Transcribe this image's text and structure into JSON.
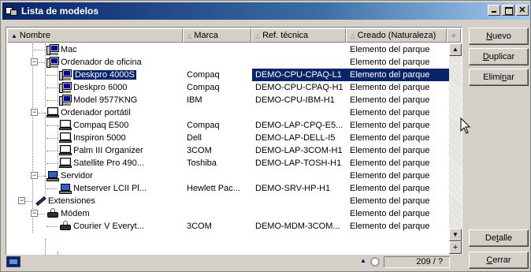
{
  "window": {
    "title": "Lista de modelos"
  },
  "columns": {
    "name": "Nombre",
    "brand": "Marca",
    "ref": "Ref. técnica",
    "created": "Creado (Naturaleza)",
    "add": "+"
  },
  "rows": [
    {
      "name": "Mac",
      "brand": "",
      "ref": "",
      "created": "Elemento del parque",
      "icon": "desktop-icon",
      "level": 2
    },
    {
      "name": "Ordenador de oficina",
      "brand": "",
      "ref": "",
      "created": "Elemento del parque",
      "icon": "desktop-icon",
      "level": 2,
      "expander": "−"
    },
    {
      "name": "Deskpro 4000S",
      "brand": "Compaq",
      "ref": "DEMO-CPU-CPAQ-L1",
      "created": "Elemento del parque",
      "icon": "desktop-icon",
      "level": 3,
      "selected": true
    },
    {
      "name": "Deskpro 6000",
      "brand": "Compaq",
      "ref": "DEMO-CPU-CPAQ-H1",
      "created": "Elemento del parque",
      "icon": "desktop-icon",
      "level": 3
    },
    {
      "name": "Model 9577KNG",
      "brand": "IBM",
      "ref": "DEMO-CPU-IBM-H1",
      "created": "Elemento del parque",
      "icon": "desktop-icon",
      "level": 3
    },
    {
      "name": "Ordenador portátil",
      "brand": "",
      "ref": "",
      "created": "Elemento del parque",
      "icon": "laptop-icon",
      "level": 2,
      "expander": "−"
    },
    {
      "name": "Compaq E500",
      "brand": "Compaq",
      "ref": "DEMO-LAP-CPQ-E5...",
      "created": "Elemento del parque",
      "icon": "laptop-icon",
      "level": 3
    },
    {
      "name": "Inspiron 5000",
      "brand": "Dell",
      "ref": "DEMO-LAP-DELL-I5",
      "created": "Elemento del parque",
      "icon": "laptop-icon",
      "level": 3
    },
    {
      "name": "Palm III Organizer",
      "brand": "3COM",
      "ref": "DEMO-LAP-3COM-H1",
      "created": "Elemento del parque",
      "icon": "laptop-icon",
      "level": 3
    },
    {
      "name": "Satellite Pro 490...",
      "brand": "Toshiba",
      "ref": "DEMO-LAP-TOSH-H1",
      "created": "Elemento del parque",
      "icon": "laptop-icon",
      "level": 3
    },
    {
      "name": "Servidor",
      "brand": "",
      "ref": "",
      "created": "Elemento del parque",
      "icon": "server-icon",
      "level": 2,
      "expander": "−"
    },
    {
      "name": "Netserver LCII Pl...",
      "brand": "Hewlett Pac...",
      "ref": "DEMO-SRV-HP-H1",
      "created": "Elemento del parque",
      "icon": "server-icon",
      "level": 3
    },
    {
      "name": "Extensiones",
      "brand": "",
      "ref": "",
      "created": "Elemento del parque",
      "icon": "extension-icon",
      "level": 1,
      "expander": "−"
    },
    {
      "name": "Módem",
      "brand": "",
      "ref": "",
      "created": "Elemento del parque",
      "icon": "modem-icon",
      "level": 2,
      "expander": "−"
    },
    {
      "name": "Courier V Everyt...",
      "brand": "3COM",
      "ref": "DEMO-MDM-3COM...",
      "created": "Elemento del parque",
      "icon": "modem-icon",
      "level": 3
    }
  ],
  "status": {
    "count": "209 / ?"
  },
  "buttons": {
    "new": "Nuevo",
    "duplicate": "Duplicar",
    "delete": "Eliminar",
    "detail": "Detalle",
    "close": "Cerrar"
  }
}
